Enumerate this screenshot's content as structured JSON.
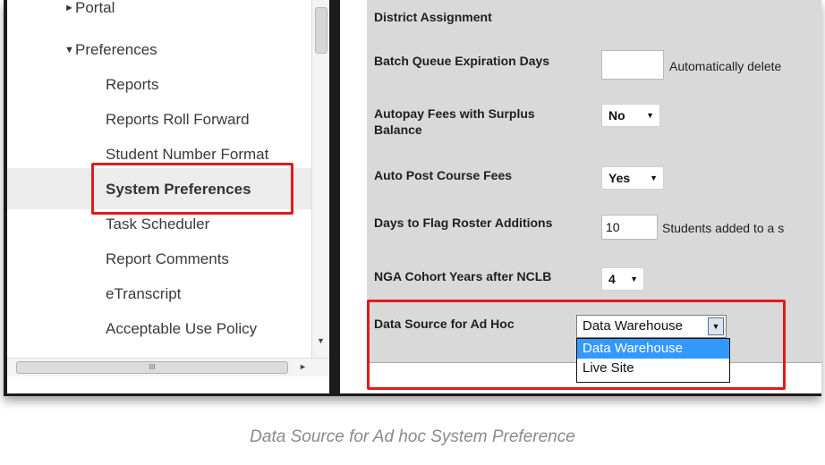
{
  "tree": {
    "portal": "Portal",
    "preferences": "Preferences",
    "children": [
      "Reports",
      "Reports Roll Forward",
      "Student Number Format",
      "System Preferences",
      "Task Scheduler",
      "Report Comments",
      "eTranscript",
      "Acceptable Use Policy"
    ],
    "hscroll_grip": "III"
  },
  "form": {
    "district_assignment": "District Assignment",
    "batch_queue_label": "Batch Queue Expiration Days",
    "batch_queue_value": "",
    "batch_queue_note": "Automatically delete",
    "autopay_label": "Autopay Fees with Surplus Balance",
    "autopay_value": "No",
    "auto_post_label": "Auto Post Course Fees",
    "auto_post_value": "Yes",
    "days_flag_label": "Days to Flag Roster Additions",
    "days_flag_value": "10",
    "days_flag_note": "Students added to a s",
    "nga_label": "NGA Cohort Years after NCLB",
    "nga_value": "4",
    "data_source_label": "Data Source for Ad Hoc",
    "data_source_value": "Data Warehouse",
    "data_source_options": [
      "Data Warehouse",
      "Live Site"
    ]
  },
  "caption": "Data Source for Ad hoc System Preference",
  "colors": {
    "highlight": "#e01b1b",
    "selected_option": "#3399ff"
  }
}
